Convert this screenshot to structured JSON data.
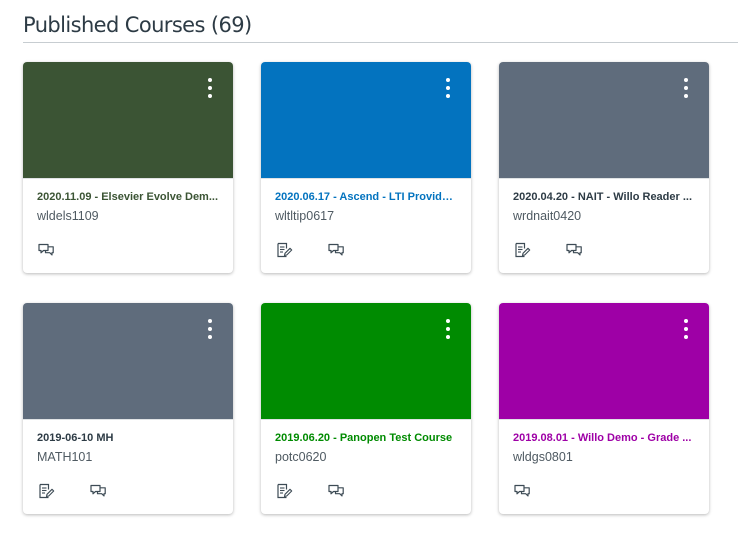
{
  "header": {
    "title": "Published Courses (69)"
  },
  "colors": {
    "grey": "#5f6c7c",
    "card_border": "#e0e3e5"
  },
  "icons": {
    "options": "kebab-vertical-icon",
    "assignments": "assignments-icon",
    "discussions": "discussions-icon"
  },
  "courses": [
    {
      "name": "2020.11.09 - Elsevier Evolve Dem...",
      "code": "wldels1109",
      "color": "#3b5434",
      "actions": [
        "discussions"
      ]
    },
    {
      "name": "2020.06.17 - Ascend - LTI Provide...",
      "code": "wltltip0617",
      "color": "#0373bf",
      "actions": [
        "assignments",
        "discussions"
      ]
    },
    {
      "name": "2020.04.20 - NAIT - Willo Reader ...",
      "code": "wrdnait0420",
      "color": "#5f6c7c",
      "actions": [
        "assignments",
        "discussions"
      ]
    },
    {
      "name": "2019-06-10 MH",
      "code": "MATH101",
      "color": "#5f6c7c",
      "actions": [
        "assignments",
        "discussions"
      ]
    },
    {
      "name": "2019.06.20 - Panopen Test Course",
      "code": "potc0620",
      "color": "#008b01",
      "actions": [
        "assignments",
        "discussions"
      ]
    },
    {
      "name": "2019.08.01 - Willo Demo - Grade ...",
      "code": "wldgs0801",
      "color": "#9e00a6",
      "actions": [
        "discussions"
      ]
    }
  ]
}
